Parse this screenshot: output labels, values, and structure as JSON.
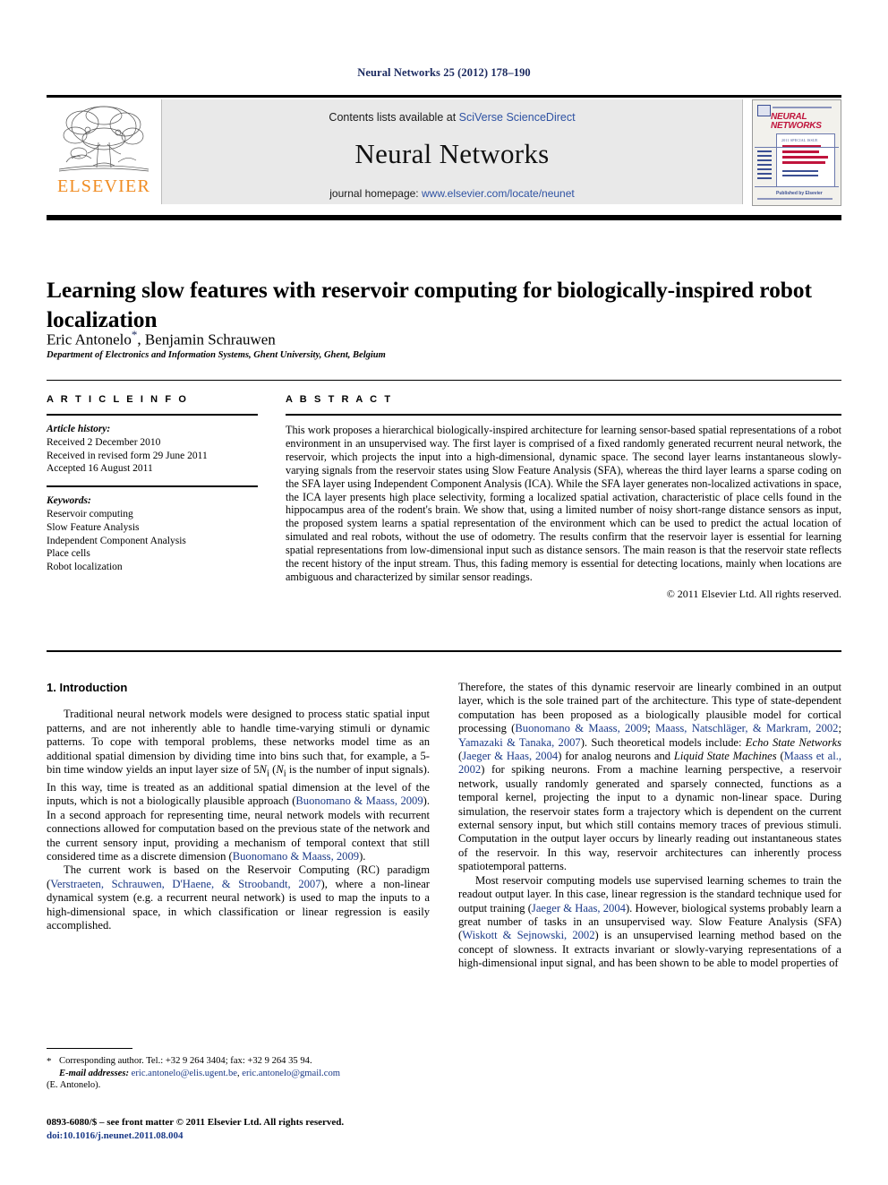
{
  "running_head": "Neural Networks 25 (2012) 178–190",
  "masthead": {
    "publisher_name": "ELSEVIER",
    "contents_prefix": "Contents lists available at ",
    "contents_brand": "SciVerse ScienceDirect",
    "journal_title": "Neural Networks",
    "homepage_prefix": "journal homepage: ",
    "homepage_url": "www.elsevier.com/locate/neunet",
    "cover": {
      "title_line1": "NEURAL",
      "title_line2": "NETWORKS",
      "issue_label": "2011 SPECIAL ISSUE",
      "feature_line1": "Multi-Scale,",
      "feature_line2": "Multi-Modal",
      "feature_line3": "Neural Modeling",
      "feature_line4": "and Simulation",
      "editor_label": "Guest Editors",
      "footer_text": "Published by Elsevier"
    }
  },
  "article": {
    "title": "Learning slow features with reservoir computing for biologically-inspired robot localization",
    "authors_part1": "Eric Antonelo",
    "authors_star": "*",
    "authors_part2": ", Benjamin Schrauwen",
    "affiliation": "Department of Electronics and Information Systems, Ghent University, Ghent, Belgium"
  },
  "info": {
    "heading": "A R T I C L E   I N F O",
    "history_label": "Article history:",
    "history": [
      "Received 2 December 2010",
      "Received in revised form 29 June 2011",
      "Accepted 16 August 2011"
    ],
    "keywords_label": "Keywords:",
    "keywords": [
      "Reservoir computing",
      "Slow Feature Analysis",
      "Independent Component Analysis",
      "Place cells",
      "Robot localization"
    ]
  },
  "abstract": {
    "heading": "A B S T R A C T",
    "text": "This work proposes a hierarchical biologically-inspired architecture for learning sensor-based spatial representations of a robot environment in an unsupervised way. The first layer is comprised of a fixed randomly generated recurrent neural network, the reservoir, which projects the input into a high-dimensional, dynamic space. The second layer learns instantaneous slowly-varying signals from the reservoir states using Slow Feature Analysis (SFA), whereas the third layer learns a sparse coding on the SFA layer using Independent Component Analysis (ICA). While the SFA layer generates non-localized activations in space, the ICA layer presents high place selectivity, forming a localized spatial activation, characteristic of place cells found in the hippocampus area of the rodent's brain. We show that, using a limited number of noisy short-range distance sensors as input, the proposed system learns a spatial representation of the environment which can be used to predict the actual location of simulated and real robots, without the use of odometry. The results confirm that the reservoir layer is essential for learning spatial representations from low-dimensional input such as distance sensors. The main reason is that the reservoir state reflects the recent history of the input stream. Thus, this fading memory is essential for detecting locations, mainly when locations are ambiguous and characterized by similar sensor readings.",
    "copyright": "© 2011 Elsevier Ltd. All rights reserved."
  },
  "body": {
    "section_heading": "1. Introduction",
    "left_paragraphs": [
      {
        "segments": [
          {
            "t": "Traditional neural network models were designed to process static spatial input patterns, and are not inherently able to handle time-varying stimuli or dynamic patterns. To cope with temporal problems, these networks model time as an additional spatial dimension by dividing time into bins such that, for example, a 5-bin time window yields an input layer size of 5"
          },
          {
            "t": "N",
            "s": "it"
          },
          {
            "t": "i",
            "s": "sub"
          },
          {
            "t": " ("
          },
          {
            "t": "N",
            "s": "it"
          },
          {
            "t": "i",
            "s": "sub"
          },
          {
            "t": " is the number of input signals). In this way, time is treated as an additional spatial dimension at the level of the inputs, which is not a biologically plausible approach ("
          },
          {
            "t": "Buonomano & Maass, 2009",
            "s": "cite"
          },
          {
            "t": "). In a second approach for representing time, neural network models with recurrent connections allowed for computation based on the previous state of the network and the current sensory input, providing a mechanism of temporal context that still considered time as a discrete dimension ("
          },
          {
            "t": "Buonomano & Maass, 2009",
            "s": "cite"
          },
          {
            "t": ")."
          }
        ]
      },
      {
        "segments": [
          {
            "t": "The current work is based on the Reservoir Computing (RC) paradigm ("
          },
          {
            "t": "Verstraeten, Schrauwen, D'Haene, & Stroobandt, 2007",
            "s": "cite"
          },
          {
            "t": "), where a non-linear dynamical system (e.g. a recurrent neural network) is used to map the inputs to a high-dimensional space, in which classification or linear regression is easily accomplished."
          }
        ]
      }
    ],
    "right_paragraphs": [
      {
        "indent": false,
        "segments": [
          {
            "t": "Therefore, the states of this dynamic reservoir are linearly combined in an output layer, which is the sole trained part of the architecture. This type of state-dependent computation has been proposed as a biologically plausible model for cortical processing ("
          },
          {
            "t": "Buonomano & Maass, 2009",
            "s": "cite"
          },
          {
            "t": "; "
          },
          {
            "t": "Maass, Natschläger, & Markram, 2002",
            "s": "cite"
          },
          {
            "t": "; "
          },
          {
            "t": "Yamazaki & Tanaka, 2007",
            "s": "cite"
          },
          {
            "t": "). Such theoretical models include: "
          },
          {
            "t": "Echo State Networks",
            "s": "it"
          },
          {
            "t": " ("
          },
          {
            "t": "Jaeger & Haas, 2004",
            "s": "cite"
          },
          {
            "t": ") for analog neurons and "
          },
          {
            "t": "Liquid State Machines",
            "s": "it"
          },
          {
            "t": " ("
          },
          {
            "t": "Maass et al., 2002",
            "s": "cite"
          },
          {
            "t": ") for spiking neurons. From a machine learning perspective, a reservoir network, usually randomly generated and sparsely connected, functions as a temporal kernel, projecting the input to a dynamic non-linear space. During simulation, the reservoir states form a trajectory which is dependent on the current external sensory input, but which still contains memory traces of previous stimuli. Computation in the output layer occurs by linearly reading out instantaneous states of the reservoir. In this way, reservoir architectures can inherently process spatiotemporal patterns."
          }
        ]
      },
      {
        "indent": true,
        "segments": [
          {
            "t": "Most reservoir computing models use supervised learning schemes to train the readout output layer. In this case, linear regression is the standard technique used for output training ("
          },
          {
            "t": "Jaeger & Haas, 2004",
            "s": "cite"
          },
          {
            "t": "). However, biological systems probably learn a great number of tasks in an unsupervised way. Slow Feature Analysis (SFA) ("
          },
          {
            "t": "Wiskott & Sejnowski, 2002",
            "s": "cite"
          },
          {
            "t": ") is an unsupervised learning method based on the concept of slowness. It extracts invariant or slowly-varying representations of a high-dimensional input signal, and has been shown to be able to model properties of"
          }
        ]
      }
    ]
  },
  "footnote": {
    "star": "*",
    "corresponding": "Corresponding author. Tel.: +32 9 264 3404; fax: +32 9 264 35 94.",
    "email_label": "E-mail addresses:",
    "email1": "eric.antonelo@elis.ugent.be",
    "email_sep": ", ",
    "email2": "eric.antonelo@gmail.com",
    "email_suffix": "(E. Antonelo)."
  },
  "imprint": {
    "issn_line": "0893-6080/$ – see front matter © 2011 Elsevier Ltd. All rights reserved.",
    "doi_prefix": "doi:",
    "doi": "10.1016/j.neunet.2011.08.004"
  }
}
